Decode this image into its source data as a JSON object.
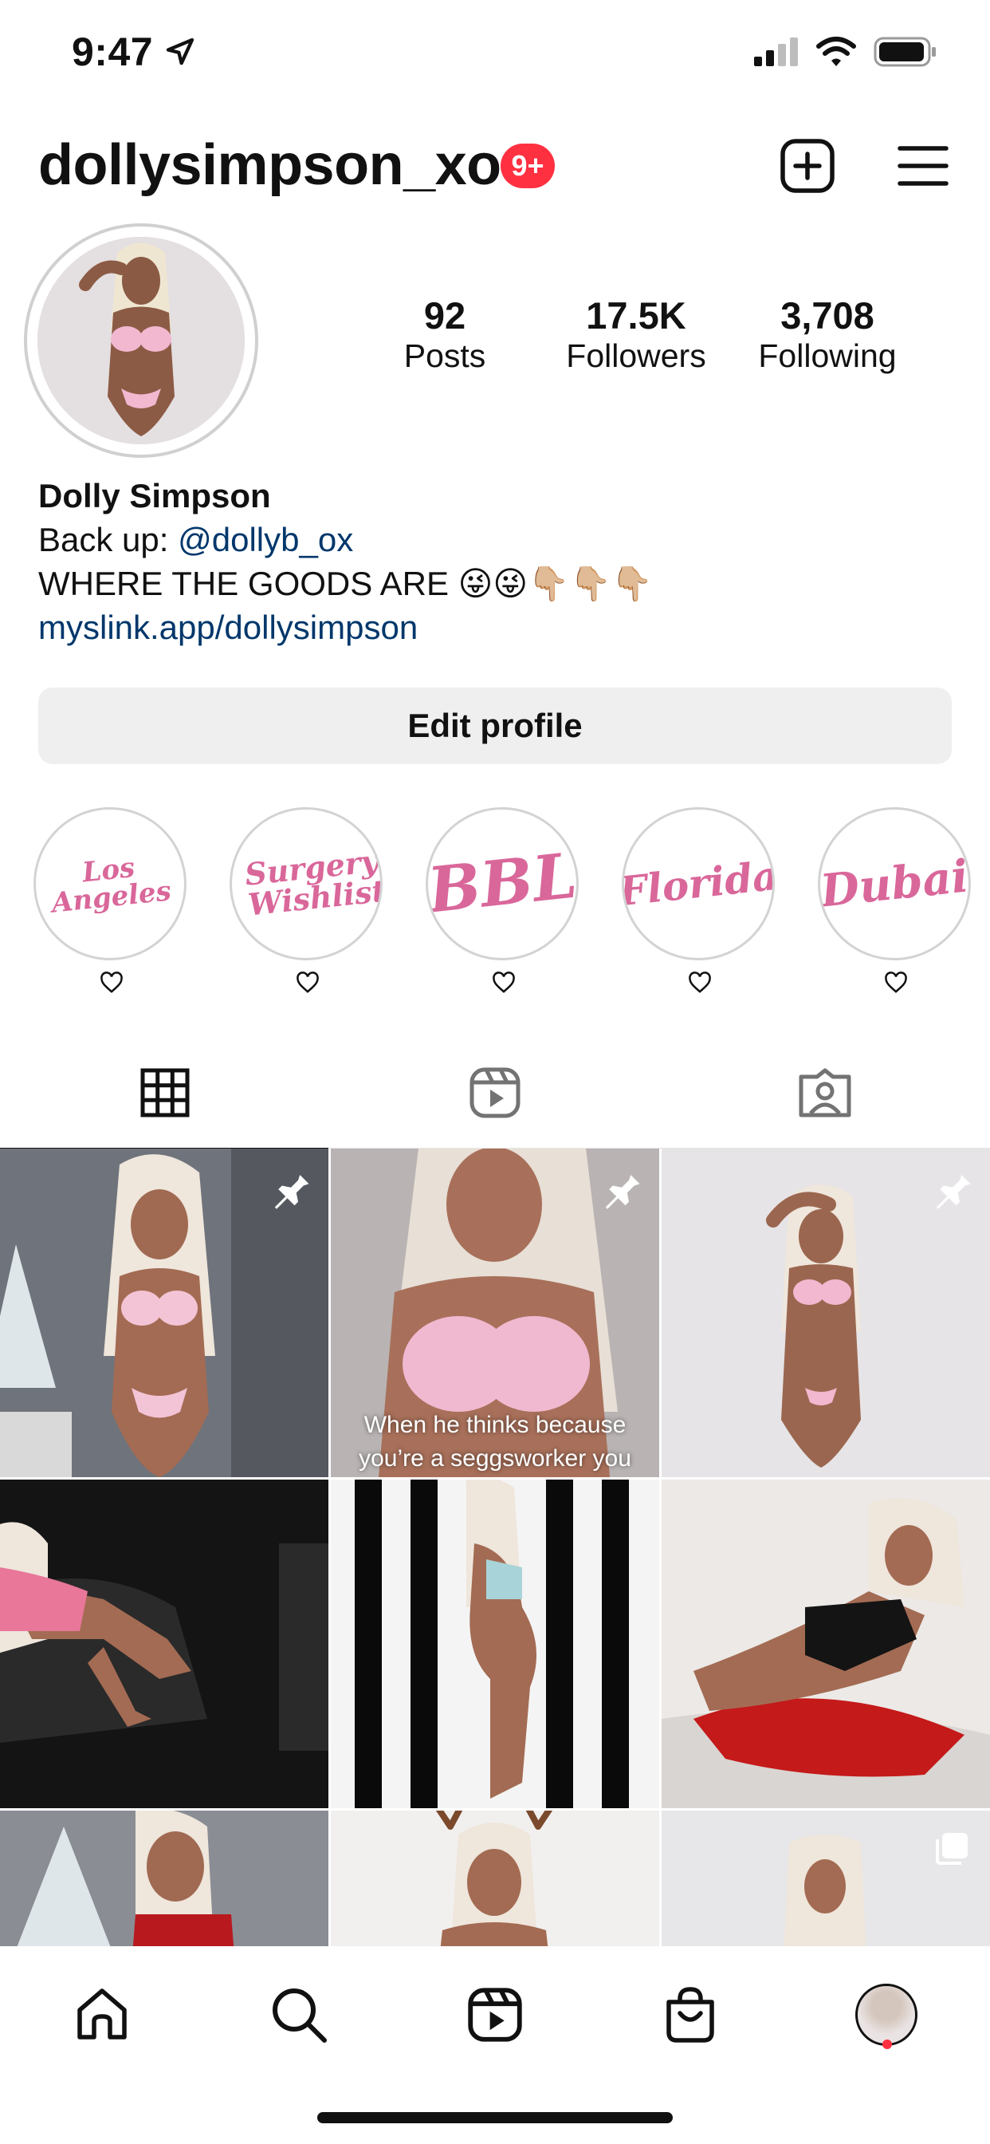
{
  "status_bar": {
    "time": "9:47"
  },
  "header": {
    "username": "dollysimpson_xo",
    "notification_badge": "9+"
  },
  "stats": [
    {
      "value": "92",
      "label": "Posts"
    },
    {
      "value": "17.5K",
      "label": "Followers"
    },
    {
      "value": "3,708",
      "label": "Following"
    }
  ],
  "bio": {
    "name": "Dolly Simpson",
    "backup_prefix": "Back up: ",
    "backup_handle": "@dollyb_ox",
    "line3": "WHERE THE GOODS ARE 😜😜👇🏼👇🏼👇🏼",
    "link": "myslink.app/dollysimpson"
  },
  "edit_profile_label": "Edit profile",
  "highlights": [
    {
      "label": "Los Angeles"
    },
    {
      "label": "Surgery Wishlist"
    },
    {
      "label": "BBL"
    },
    {
      "label": "Florida"
    },
    {
      "label": "Dubai"
    }
  ],
  "grid": {
    "caption_post_2": "When he thinks because you’re a seggsworker you"
  },
  "colors": {
    "notification_red": "#ff3040",
    "link_blue": "#00376b",
    "highlight_pink": "#d9679a",
    "button_gray": "#efefef"
  },
  "icons": {
    "status": [
      "location-arrow-icon",
      "signal-icon",
      "wifi-icon",
      "battery-icon"
    ],
    "header": [
      "create-post-icon",
      "menu-icon"
    ],
    "tabs": [
      "grid-icon",
      "reels-icon",
      "tagged-icon"
    ],
    "bottom_nav": [
      "home-icon",
      "search-icon",
      "reels-icon",
      "shop-icon",
      "profile-avatar"
    ]
  }
}
